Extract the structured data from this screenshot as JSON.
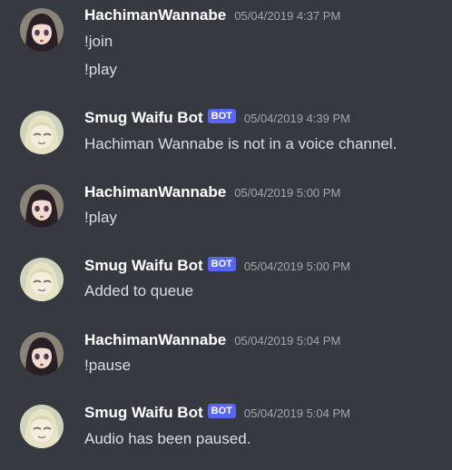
{
  "messages": [
    {
      "author": "HachimanWannabe",
      "bot": false,
      "avatar_icon": "dark-haired-girl-avatar",
      "timestamp": "05/04/2019 4:37 PM",
      "lines": [
        "!join",
        "!play"
      ]
    },
    {
      "author": "Smug Waifu Bot",
      "bot": true,
      "bot_label": "BOT",
      "avatar_icon": "blonde-girl-avatar",
      "timestamp": "05/04/2019 4:39 PM",
      "lines": [
        "Hachiman Wannabe is not in a voice channel."
      ]
    },
    {
      "author": "HachimanWannabe",
      "bot": false,
      "avatar_icon": "dark-haired-girl-avatar",
      "timestamp": "05/04/2019 5:00 PM",
      "lines": [
        "!play"
      ]
    },
    {
      "author": "Smug Waifu Bot",
      "bot": true,
      "bot_label": "BOT",
      "avatar_icon": "blonde-girl-avatar",
      "timestamp": "05/04/2019 5:00 PM",
      "lines": [
        "Added to queue"
      ]
    },
    {
      "author": "HachimanWannabe",
      "bot": false,
      "avatar_icon": "dark-haired-girl-avatar",
      "timestamp": "05/04/2019 5:04 PM",
      "lines": [
        "!pause"
      ]
    },
    {
      "author": "Smug Waifu Bot",
      "bot": true,
      "bot_label": "BOT",
      "avatar_icon": "blonde-girl-avatar",
      "timestamp": "05/04/2019 5:04 PM",
      "lines": [
        "Audio has been paused."
      ]
    }
  ],
  "colors": {
    "background": "#36393f",
    "username": "#ffffff",
    "message_text": "#dcddde",
    "timestamp": "#a3a6aa",
    "bot_badge": "#5865f2"
  }
}
